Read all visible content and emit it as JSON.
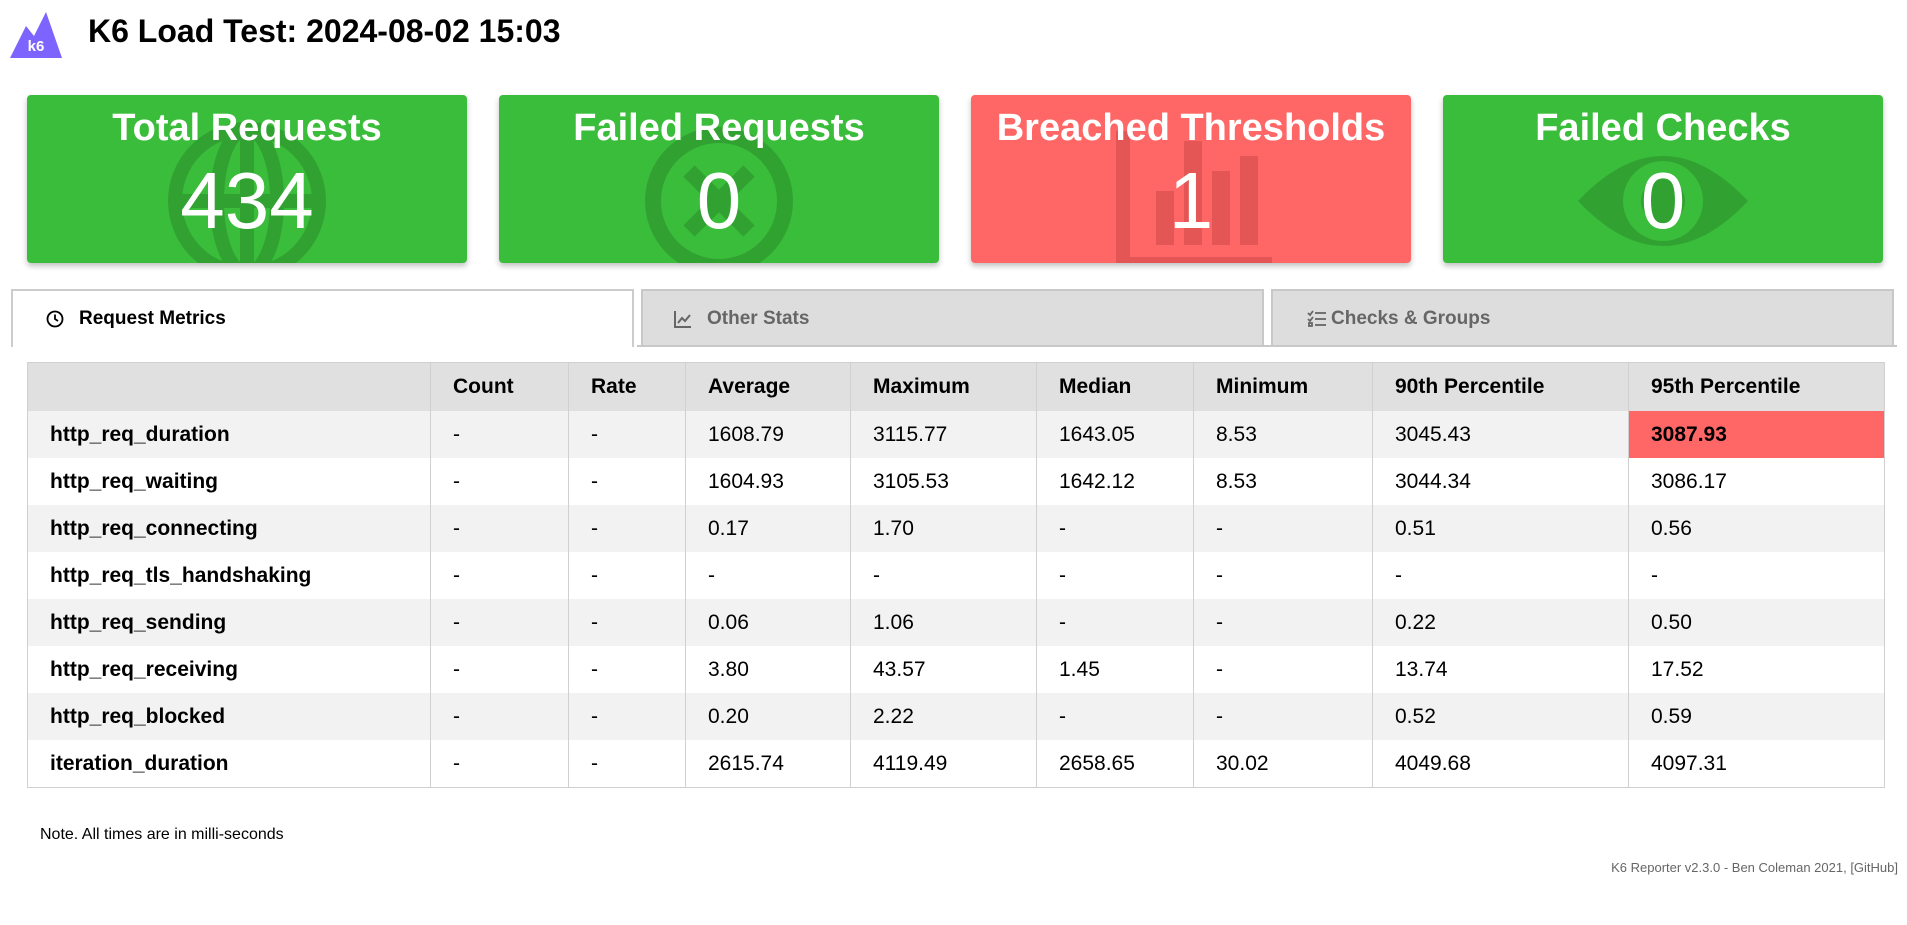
{
  "header": {
    "logo_text": "k6",
    "title": "K6 Load Test: 2024-08-02 15:03"
  },
  "colors": {
    "pass": "#3abd3a",
    "fail": "#ff6666",
    "logo": "#7d64ff"
  },
  "cards": [
    {
      "title": "Total Requests",
      "value": "434",
      "status": "pass",
      "icon": "globe-icon"
    },
    {
      "title": "Failed Requests",
      "value": "0",
      "status": "pass",
      "icon": "circle-x-icon"
    },
    {
      "title": "Breached Thresholds",
      "value": "1",
      "status": "fail",
      "icon": "bar-chart-icon"
    },
    {
      "title": "Failed Checks",
      "value": "0",
      "status": "pass",
      "icon": "eye-icon"
    }
  ],
  "tabs": [
    {
      "label": "Request Metrics",
      "icon": "clock-icon",
      "active": true
    },
    {
      "label": "Other Stats",
      "icon": "line-chart-icon",
      "active": false
    },
    {
      "label": "Checks & Groups",
      "icon": "checklist-icon",
      "active": false
    }
  ],
  "table": {
    "columns": [
      "",
      "Count",
      "Rate",
      "Average",
      "Maximum",
      "Median",
      "Minimum",
      "90th Percentile",
      "95th Percentile"
    ],
    "rows": [
      {
        "metric": "http_req_duration",
        "values": [
          "-",
          "-",
          "1608.79",
          "3115.77",
          "1643.05",
          "8.53",
          "3045.43",
          "3087.93"
        ],
        "breached_index": 7
      },
      {
        "metric": "http_req_waiting",
        "values": [
          "-",
          "-",
          "1604.93",
          "3105.53",
          "1642.12",
          "8.53",
          "3044.34",
          "3086.17"
        ]
      },
      {
        "metric": "http_req_connecting",
        "values": [
          "-",
          "-",
          "0.17",
          "1.70",
          "-",
          "-",
          "0.51",
          "0.56"
        ]
      },
      {
        "metric": "http_req_tls_handshaking",
        "values": [
          "-",
          "-",
          "-",
          "-",
          "-",
          "-",
          "-",
          "-"
        ]
      },
      {
        "metric": "http_req_sending",
        "values": [
          "-",
          "-",
          "0.06",
          "1.06",
          "-",
          "-",
          "0.22",
          "0.50"
        ]
      },
      {
        "metric": "http_req_receiving",
        "values": [
          "-",
          "-",
          "3.80",
          "43.57",
          "1.45",
          "-",
          "13.74",
          "17.52"
        ]
      },
      {
        "metric": "http_req_blocked",
        "values": [
          "-",
          "-",
          "0.20",
          "2.22",
          "-",
          "-",
          "0.52",
          "0.59"
        ]
      },
      {
        "metric": "iteration_duration",
        "values": [
          "-",
          "-",
          "2615.74",
          "4119.49",
          "2658.65",
          "30.02",
          "4049.68",
          "4097.31"
        ]
      }
    ]
  },
  "note": "Note. All times are in milli-seconds",
  "footer": {
    "text": "K6 Reporter v2.3.0 - Ben Coleman 2021, ",
    "link_label": "[GitHub]"
  }
}
